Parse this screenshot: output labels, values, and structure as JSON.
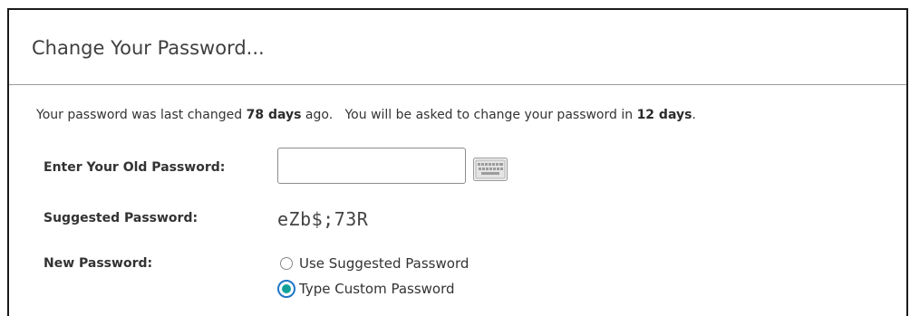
{
  "page": {
    "title": "Change Your Password..."
  },
  "info": {
    "prefix": "Your password was last changed ",
    "days_since_change": "78 days",
    "middle": " ago.   You will be asked to change your password in ",
    "days_until_required": "12 days",
    "suffix": "."
  },
  "form": {
    "old_password_label": "Enter Your Old Password:",
    "old_password_value": "",
    "keyboard_icon": "keyboard-icon",
    "suggested_label": "Suggested Password:",
    "suggested_value": "eZb$;73R",
    "new_password_label": "New Password:",
    "options": [
      {
        "label": "Use Suggested Password",
        "selected": false
      },
      {
        "label": "Type Custom Password",
        "selected": true
      }
    ]
  },
  "colors": {
    "radio_selected_ring": "#1f76c8",
    "radio_selected_dot": "#12a19a",
    "panel_border": "#1a1a1a"
  }
}
